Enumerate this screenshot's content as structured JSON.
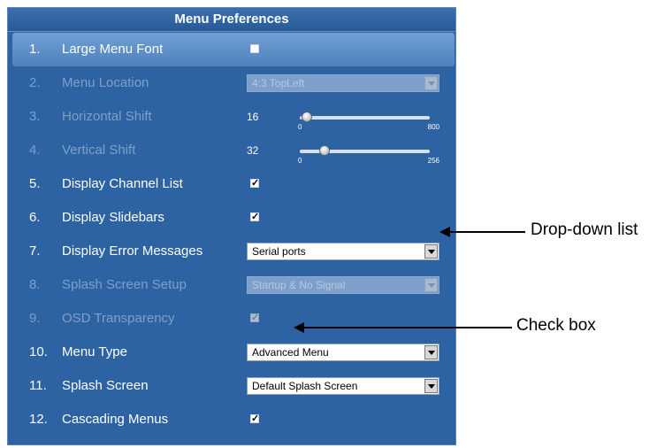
{
  "panel": {
    "title": "Menu Preferences"
  },
  "rows": [
    {
      "num": "1.",
      "label": "Large Menu Font"
    },
    {
      "num": "2.",
      "label": "Menu Location",
      "dropdown": "4:3  TopLeft"
    },
    {
      "num": "3.",
      "label": "Horizontal Shift",
      "value": "16",
      "min": "0",
      "max": "800",
      "level": 0.02
    },
    {
      "num": "4.",
      "label": "Vertical Shift",
      "value": "32",
      "min": "0",
      "max": "256",
      "level": 0.125
    },
    {
      "num": "5.",
      "label": "Display Channel List",
      "check": "✓"
    },
    {
      "num": "6.",
      "label": "Display Slidebars",
      "check": "✓"
    },
    {
      "num": "7.",
      "label": "Display Error Messages",
      "dropdown": "Serial ports"
    },
    {
      "num": "8.",
      "label": "Splash Screen Setup",
      "dropdown": "Startup & No Signal"
    },
    {
      "num": "9.",
      "label": "OSD Transparency",
      "check": "✓"
    },
    {
      "num": "10.",
      "label": "Menu Type",
      "dropdown": "Advanced Menu"
    },
    {
      "num": "11.",
      "label": "Splash Screen",
      "dropdown": "Default Splash Screen"
    },
    {
      "num": "12.",
      "label": "Cascading Menus",
      "check": "✓"
    }
  ],
  "annotations": {
    "dropdown_label": "Drop-down list",
    "checkbox_label": "Check box"
  }
}
